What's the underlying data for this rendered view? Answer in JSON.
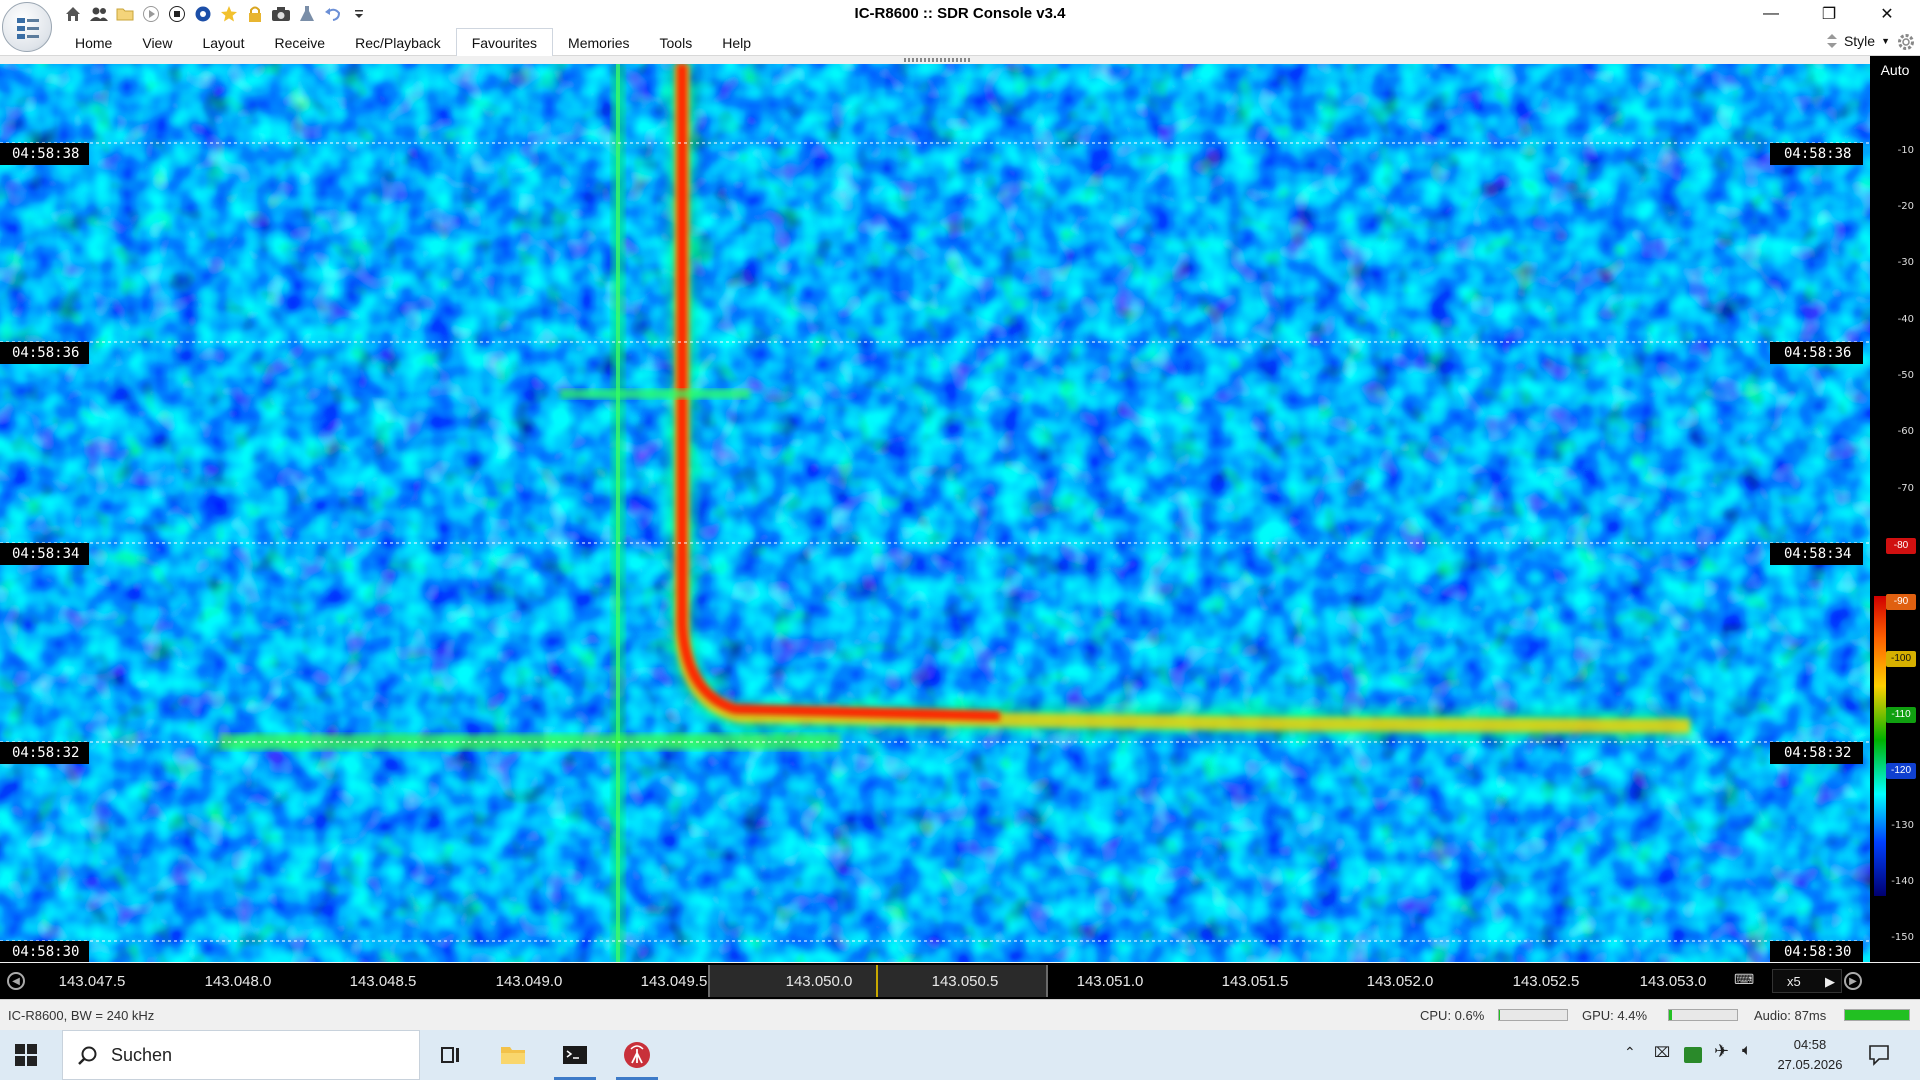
{
  "window": {
    "title": "IC-R8600 :: SDR Console v3.4",
    "controls": {
      "minimize": "—",
      "restore": "❐",
      "close": "✕"
    }
  },
  "quick_access": [
    "home-icon",
    "users-icon",
    "folder-icon",
    "play-icon",
    "stop-icon",
    "record-icon",
    "star-icon",
    "lock-icon",
    "camera-icon",
    "flask-icon",
    "undo-icon",
    "dropdown-icon"
  ],
  "menu": {
    "items": [
      "Home",
      "View",
      "Layout",
      "Receive",
      "Rec/Playback",
      "Favourites",
      "Memories",
      "Tools",
      "Help"
    ],
    "active": "Favourites",
    "style_label": "Style"
  },
  "waterfall": {
    "time_labels": [
      "04:58:38",
      "04:58:36",
      "04:58:34",
      "04:58:32",
      "04:58:30"
    ]
  },
  "scale": {
    "auto_label": "Auto",
    "ticks": [
      "-10",
      "-20",
      "-30",
      "-40",
      "-50",
      "-60",
      "-70",
      "-80",
      "-90",
      "-100",
      "-110",
      "-120",
      "-130",
      "-140",
      "-150"
    ],
    "colors": {
      "high": "#d00000",
      "mid": "#ffd000",
      "low": "#0040ff"
    }
  },
  "frequency": {
    "labels": [
      "143.047.5",
      "143.048.0",
      "143.048.5",
      "143.049.0",
      "143.049.5",
      "143.050.0",
      "143.050.5",
      "143.051.0",
      "143.051.5",
      "143.052.0",
      "143.052.5",
      "143.053.0"
    ],
    "zoom": "x5"
  },
  "status": {
    "left": "IC-R8600, BW = 240 kHz",
    "cpu_label": "CPU: 0.6%",
    "cpu_level": 0.006,
    "gpu_label": "GPU: 4.4%",
    "gpu_level": 0.044,
    "audio_label": "Audio: 87ms",
    "audio_level": 1.0
  },
  "taskbar": {
    "search_placeholder": "Suchen",
    "time": "04:58",
    "date": "27.05.2026"
  }
}
